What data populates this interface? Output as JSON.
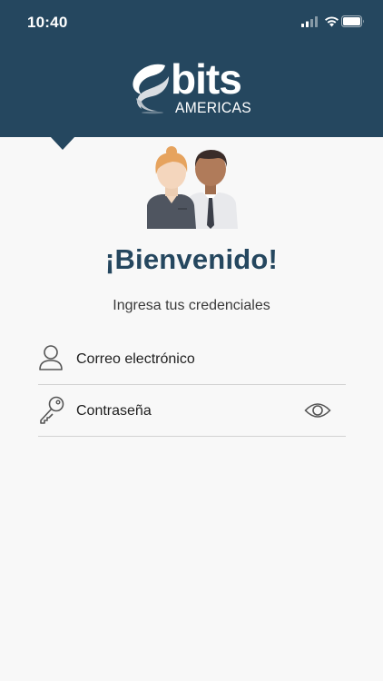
{
  "status_bar": {
    "time": "10:40"
  },
  "logo": {
    "word": "bits",
    "sub": "AMERICAS"
  },
  "welcome": {
    "title": "¡Bienvenido!",
    "subtitle": "Ingresa tus credenciales"
  },
  "form": {
    "email_placeholder": "Correo electrónico",
    "password_placeholder": "Contraseña"
  },
  "colors": {
    "header": "#25475f",
    "title": "#25475f",
    "background": "#f8f8f8"
  },
  "icons": [
    "signal-icon",
    "wifi-icon",
    "battery-icon",
    "user-icon",
    "key-icon",
    "eye-icon"
  ]
}
